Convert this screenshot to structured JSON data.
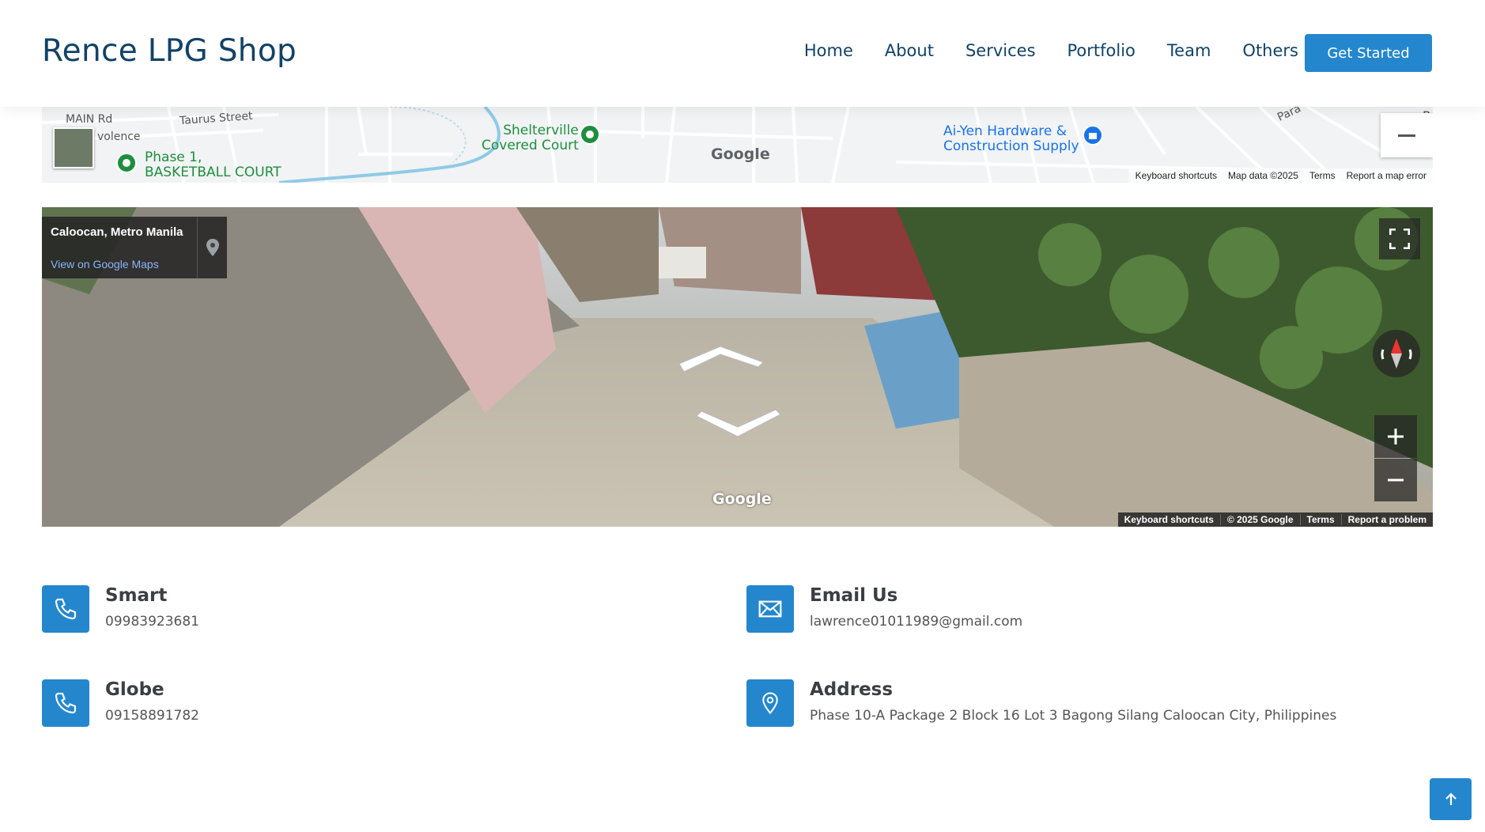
{
  "header": {
    "logo": "Rence LPG Shop",
    "nav": [
      {
        "label": "Home"
      },
      {
        "label": "About"
      },
      {
        "label": "Services"
      },
      {
        "label": "Portfolio"
      },
      {
        "label": "Team"
      },
      {
        "label": "Others"
      }
    ],
    "cta_label": "Get Started"
  },
  "map": {
    "labels": {
      "main_rd": "MAIN Rd",
      "taurus": "Taurus Street",
      "volence": "volence",
      "phase1_l1": "Phase 1,",
      "phase1_l2": "BASKETBALL COURT",
      "shelter_l1": "Shelterville",
      "shelter_l2": "Covered Court",
      "aiyen_l1": "Ai-Yen Hardware &",
      "aiyen_l2": "Construction Supply",
      "para": "Para",
      "p": "P"
    },
    "google": "Google",
    "attribution": [
      "Keyboard shortcuts",
      "Map data ©2025",
      "Terms",
      "Report a map error"
    ]
  },
  "streetview": {
    "place": "Caloocan, Metro Manila",
    "view_link": "View on Google Maps",
    "google": "Google",
    "attribution": [
      "Keyboard shortcuts",
      "© 2025 Google",
      "Terms",
      "Report a problem"
    ]
  },
  "contacts": [
    {
      "title": "Smart",
      "value": "09983923681",
      "icon": "phone-icon"
    },
    {
      "title": "Email Us",
      "value": "lawrence01011989@gmail.com",
      "icon": "envelope-icon"
    },
    {
      "title": "Globe",
      "value": "09158891782",
      "icon": "phone-icon"
    },
    {
      "title": "Address",
      "value": "Phase 10-A Package 2 Block 16 Lot 3 Bagong Silang Caloocan City, Philippines",
      "icon": "map-pin-icon"
    }
  ],
  "colors": {
    "accent": "#2487ce",
    "brand_text": "#124265"
  }
}
